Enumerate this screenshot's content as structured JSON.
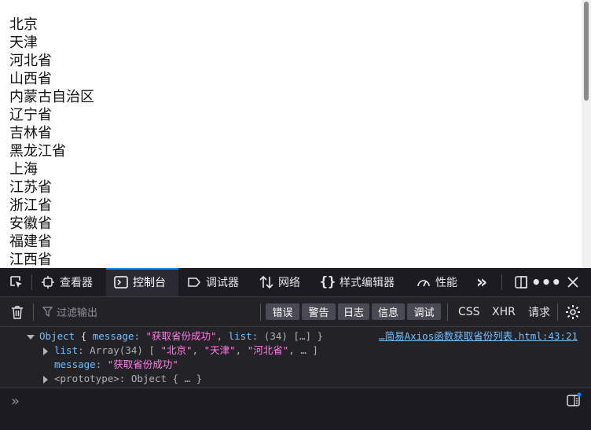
{
  "page": {
    "provinces": [
      "北京",
      "天津",
      "河北省",
      "山西省",
      "内蒙古自治区",
      "辽宁省",
      "吉林省",
      "黑龙江省",
      "上海",
      "江苏省",
      "浙江省",
      "安徽省",
      "福建省",
      "江西省"
    ]
  },
  "devtools": {
    "tabs": [
      {
        "label": "查看器",
        "icon": "inspector-icon"
      },
      {
        "label": "控制台",
        "icon": "console-icon",
        "active": true
      },
      {
        "label": "调试器",
        "icon": "debugger-icon"
      },
      {
        "label": "网络",
        "icon": "network-icon"
      },
      {
        "label": "样式编辑器",
        "icon": "style-editor-icon"
      },
      {
        "label": "性能",
        "icon": "performance-icon"
      }
    ],
    "filter_placeholder": "过滤输出",
    "levels": [
      "错误",
      "警告",
      "日志",
      "信息",
      "调试"
    ],
    "type_filters": [
      "CSS",
      "XHR",
      "请求"
    ],
    "accent": "#0a84ff"
  },
  "console": {
    "entry": {
      "keyword": "Object",
      "brace_open": "{",
      "message_key": "message",
      "message_value": "\"获取省份成功\"",
      "list_key": "list",
      "list_preview": "(34) […] }",
      "source": "…简易Axios函数获取省份列表.html:43:21",
      "children": [
        {
          "key": "list",
          "value_prefix": "Array(34) [ ",
          "items": [
            "\"北京\"",
            "\"天津\"",
            "\"河北省\""
          ],
          "value_suffix": ", … ]"
        },
        {
          "key": "message",
          "value": "\"获取省份成功\""
        },
        {
          "key": "<prototype>",
          "value": "Object { … }"
        }
      ]
    },
    "prompt": "»"
  }
}
